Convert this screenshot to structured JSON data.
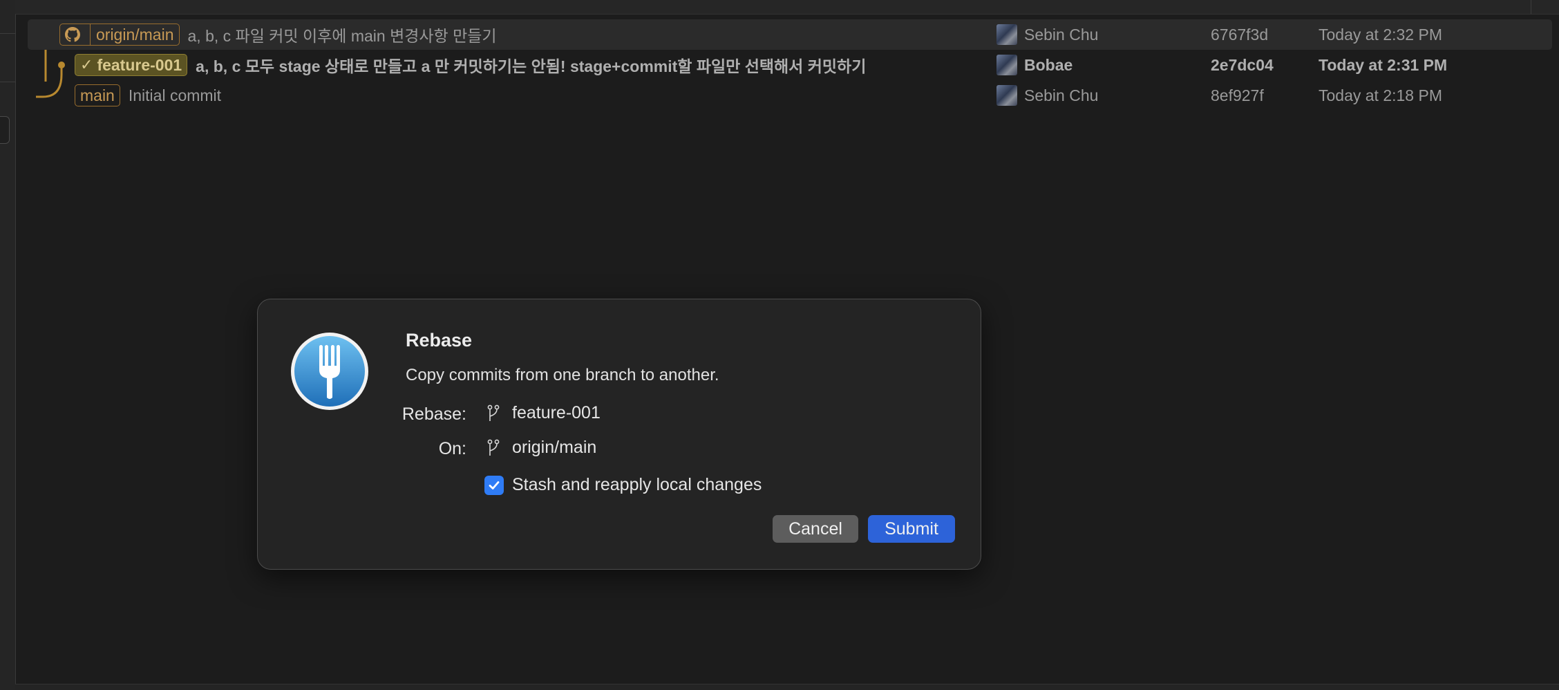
{
  "commits": [
    {
      "refs": [
        {
          "label": "origin/main",
          "kind": "remote",
          "icon": "github-icon"
        }
      ],
      "subject": "a, b, c 파일 커밋 이후에 main 변경사항 만들기",
      "author": "Sebin Chu",
      "sha": "6767f3d",
      "date": "Today at 2:32 PM",
      "selected": true,
      "bold": false
    },
    {
      "refs": [
        {
          "label": "feature-001",
          "kind": "head",
          "icon": "checkmark-icon"
        }
      ],
      "subject": "a, b, c 모두 stage 상태로 만들고 a 만 커밋하기는 안됨! stage+commit할 파일만 선택해서 커밋하기",
      "author": "Bobae",
      "sha": "2e7dc04",
      "date": "Today at 2:31 PM",
      "selected": false,
      "bold": true
    },
    {
      "refs": [
        {
          "label": "main",
          "kind": "local"
        }
      ],
      "subject": "Initial commit",
      "author": "Sebin Chu",
      "sha": "8ef927f",
      "date": "Today at 2:18 PM",
      "selected": false,
      "bold": false
    }
  ],
  "dialog": {
    "title": "Rebase",
    "subtitle": "Copy commits from one branch to another.",
    "rebase_label": "Rebase:",
    "rebase_value": "feature-001",
    "on_label": "On:",
    "on_value": "origin/main",
    "stash_label": "Stash and reapply local changes",
    "stash_checked": true,
    "cancel_label": "Cancel",
    "submit_label": "Submit"
  },
  "colors": {
    "background": "#1c1c1c",
    "graph_line": "#b8892f",
    "badge_border": "#9a6e2e",
    "head_badge_bg": "#5b5323",
    "accent_blue": "#2d63d9",
    "checkbox_blue": "#2f7cf6"
  }
}
